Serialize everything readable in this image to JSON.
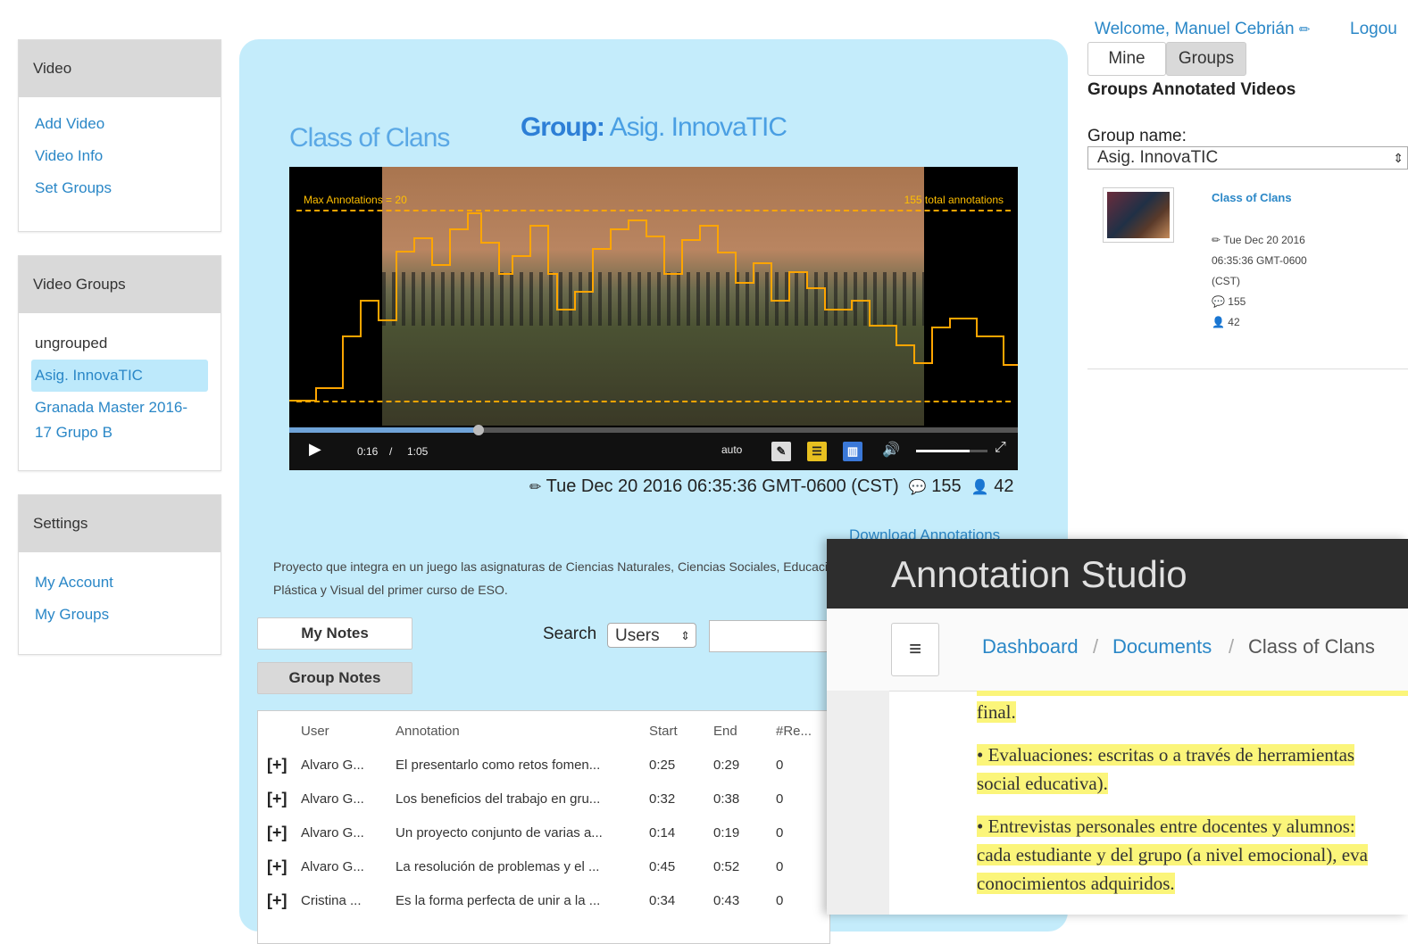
{
  "sidebar": {
    "video": {
      "heading": "Video",
      "links": [
        "Add Video",
        "Video Info",
        "Set Groups"
      ]
    },
    "video_groups": {
      "heading": "Video Groups",
      "items": [
        "ungrouped",
        "Asig. InnovaTIC",
        "Granada Master 2016-",
        "17 Grupo B"
      ],
      "active_item": "Asig. InnovaTIC"
    },
    "settings": {
      "heading": "Settings",
      "links": [
        "My Account",
        "My Groups"
      ]
    }
  },
  "main": {
    "group_label": "Group:",
    "group_name": "Asig. InnovaTIC",
    "video_title": "Class of Clans",
    "video": {
      "max_label": "Max Annotations = 20",
      "total_label": "155 total annotations",
      "time_current": "0:16",
      "time_separator": "/",
      "time_total": "1:05",
      "quality": "auto",
      "progress_fraction": 0.26,
      "volume_fraction": 0.75
    },
    "meta": {
      "date": "Tue Dec 20 2016 06:35:36 GMT-0600 (CST)",
      "annotations": "155",
      "users": "42"
    },
    "download_link": "Download Annotations",
    "description": "Proyecto que integra en un juego las asignaturas de Ciencias Naturales, Ciencias Sociales, Educación Plástica y Visual del primer curso de ESO.",
    "tabs": {
      "my_notes": "My Notes",
      "group_notes": "Group Notes"
    },
    "search": {
      "label": "Search",
      "select_value": "Users",
      "input_value": ""
    },
    "table": {
      "headers": [
        "User",
        "Annotation",
        "Start",
        "End",
        "#Re..."
      ],
      "rows": [
        {
          "expand": "[+]",
          "user": "Alvaro G...",
          "annotation": "El presentarlo como retos fomen...",
          "start": "0:25",
          "end": "0:29",
          "replies": "0"
        },
        {
          "expand": "[+]",
          "user": "Alvaro G...",
          "annotation": "Los beneficios del trabajo en gru...",
          "start": "0:32",
          "end": "0:38",
          "replies": "0"
        },
        {
          "expand": "[+]",
          "user": "Alvaro G...",
          "annotation": "Un proyecto conjunto de varias a...",
          "start": "0:14",
          "end": "0:19",
          "replies": "0"
        },
        {
          "expand": "[+]",
          "user": "Alvaro G...",
          "annotation": "La resolución de problemas y el ...",
          "start": "0:45",
          "end": "0:52",
          "replies": "0"
        },
        {
          "expand": "[+]",
          "user": "Cristina ...",
          "annotation": "Es la forma perfecta de unir a la ...",
          "start": "0:34",
          "end": "0:43",
          "replies": "0"
        }
      ]
    }
  },
  "right": {
    "welcome": "Welcome, Manuel Cebrián",
    "logout": "Logou",
    "tabs": [
      "Mine",
      "Groups"
    ],
    "heading": "Groups Annotated Videos",
    "group_name_label": "Group name:",
    "group_select": "Asig. InnovaTIC",
    "video_card": {
      "title": "Class of Clans",
      "date_line1": "Tue Dec 20 2016",
      "date_line2": "06:35:36 GMT-0600",
      "date_line3": "(CST)",
      "annotations": "155",
      "users": "42"
    }
  },
  "studio": {
    "title": "Annotation Studio",
    "breadcrumb": [
      "Dashboard",
      "Documents",
      "Class of Clans"
    ],
    "doc_lines": [
      "final.",
      "• Evaluaciones: escritas o a través de herramientas",
      "social educativa).",
      "• Entrevistas personales entre docentes y alumnos:",
      "cada estudiante y del grupo (a nivel emocional), eva",
      "conocimientos adquiridos."
    ]
  },
  "colors": {
    "card_bg": "#c4ecfb",
    "link": "#2a87c7",
    "highlight": "#fbf57a",
    "studio_header": "#2d2d2d",
    "graph_line": "#ffa500"
  }
}
